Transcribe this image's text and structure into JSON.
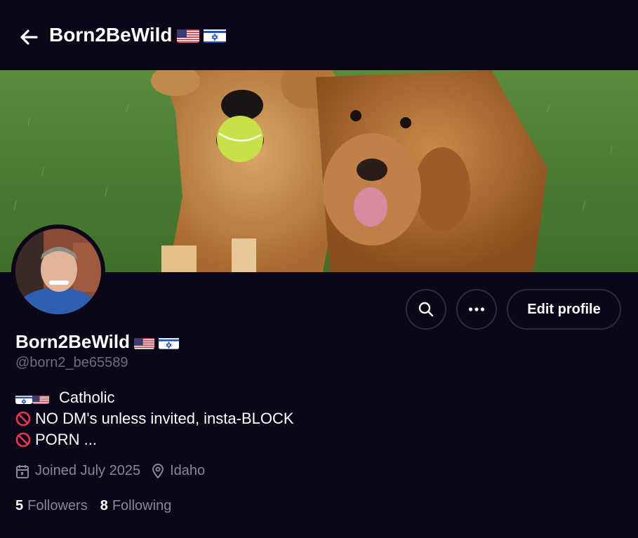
{
  "header": {
    "title": "Born2BeWild",
    "flags": [
      "us-flag-icon",
      "israel-flag-icon"
    ]
  },
  "profile": {
    "display_name": "Born2BeWild",
    "handle": "@born2_be65589",
    "bio": {
      "line1": "Catholic",
      "line2": "NO DM's unless invited, insta-BLOCK",
      "line3": "PORN  ..."
    },
    "joined": "Joined July 2025",
    "location": "Idaho",
    "followers_count": "5",
    "followers_label": "Followers",
    "following_count": "8",
    "following_label": "Following"
  },
  "actions": {
    "edit_profile": "Edit profile"
  },
  "colors": {
    "background": "#0b0718",
    "muted_text": "#8a869a",
    "border": "#2e2a44"
  }
}
